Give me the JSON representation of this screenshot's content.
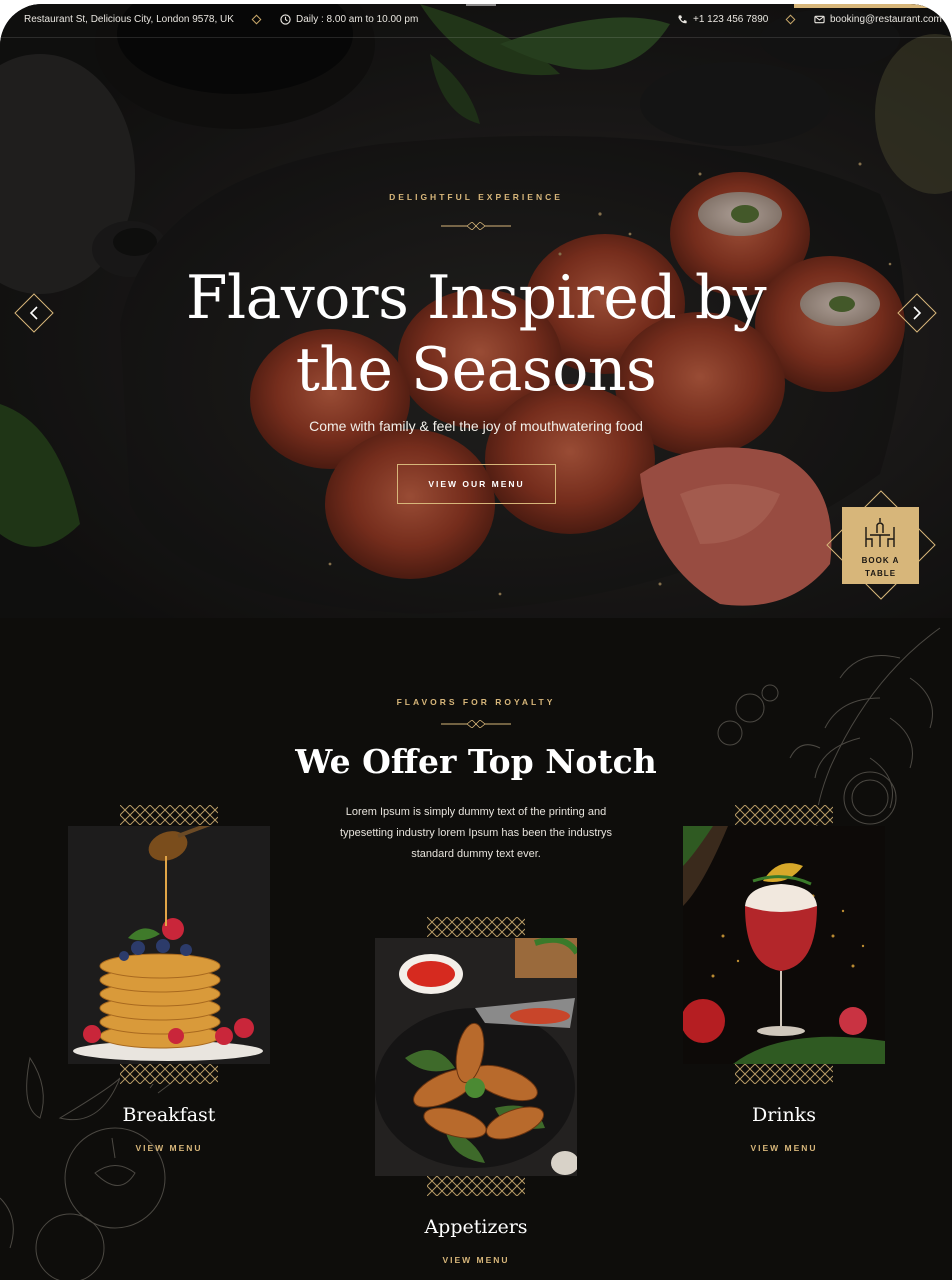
{
  "topbar": {
    "address": "Restaurant St, Delicious City, London 9578, UK",
    "hours": "Daily : 8.00 am to 10.00 pm",
    "phone": "+1 123 456 7890",
    "email": "booking@restaurant.com"
  },
  "hero": {
    "eyebrow": "DELIGHTFUL EXPERIENCE",
    "title_line1": "Flavors Inspired by",
    "title_line2": "the Seasons",
    "subtitle": "Come with family & feel the joy of mouthwatering food",
    "button_label": "VIEW OUR MENU"
  },
  "book_table": {
    "line1": "BOOK A",
    "line2": "TABLE"
  },
  "offer": {
    "eyebrow": "FLAVORS FOR ROYALTY",
    "title": "We Offer Top Notch",
    "desc_line1": "Lorem Ipsum is simply dummy text of the printing and",
    "desc_line2": "typesetting industry lorem Ipsum has been the industrys",
    "desc_line3": "standard dummy text ever."
  },
  "categories": [
    {
      "name": "Breakfast",
      "link": "VIEW MENU"
    },
    {
      "name": "Appetizers",
      "link": "VIEW MENU"
    },
    {
      "name": "Drinks",
      "link": "VIEW MENU"
    }
  ],
  "colors": {
    "gold": "#d7b67a",
    "background": "#0e0d0b",
    "text": "#ffffff"
  }
}
